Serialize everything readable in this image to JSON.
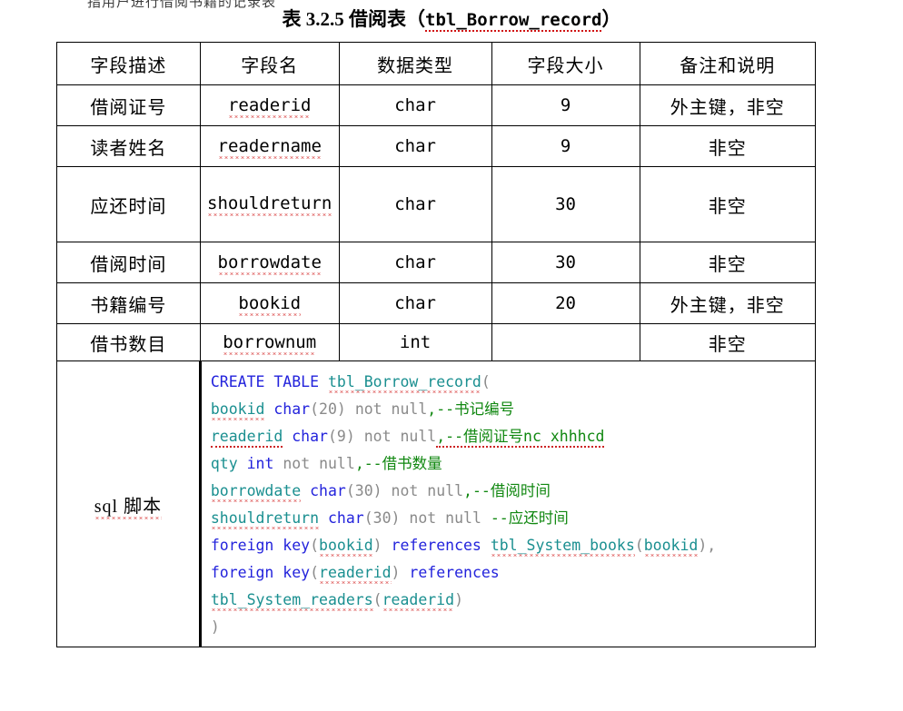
{
  "page": {
    "top_cut_text": "指用户进行借阅书籍的记录表",
    "title_prefix": "表 3.2.5 借阅表（",
    "title_code": "tbl_Borrow_record",
    "title_suffix": "）"
  },
  "table": {
    "headers": [
      "字段描述",
      "字段名",
      "数据类型",
      "字段大小",
      "备注和说明"
    ],
    "rows": [
      {
        "desc": "借阅证号",
        "field": "readerid",
        "type": "char",
        "size": "9",
        "note": "外主键，非空"
      },
      {
        "desc": "读者姓名",
        "field": "readername",
        "type": "char",
        "size": "9",
        "note": "非空"
      },
      {
        "desc": "应还时间",
        "field": "shouldreturn",
        "type": "char",
        "size": "30",
        "note": "非空"
      },
      {
        "desc": "借阅时间",
        "field": "borrowdate",
        "type": "char",
        "size": "30",
        "note": "非空"
      },
      {
        "desc": "书籍编号",
        "field": "bookid",
        "type": "char",
        "size": "20",
        "note": "外主键，非空"
      },
      {
        "desc": "借书数目",
        "field": "borrownum",
        "type": "int",
        "size": "",
        "note": "非空"
      }
    ],
    "sql_label": "sql 脚本"
  },
  "sql": {
    "l1_kw": "CREATE TABLE",
    "l1_id": "tbl_Borrow_record",
    "l1_punc": "(",
    "l2_id": "bookid",
    "l2_type": "char",
    "l2_size": "(20)",
    "l2_gray": "not null",
    "l2_cmt": ",--书记编号",
    "l3_id": "readerid",
    "l3_type": "char",
    "l3_size": "(9)",
    "l3_gray": "not null",
    "l3_cmt": ",--借阅证号nc xhhhcd",
    "l4_id": "qty",
    "l4_type": "int",
    "l4_gray": "not null",
    "l4_cmt": ",--借书数量",
    "l5_id": "borrowdate",
    "l5_type": "char",
    "l5_size": "(30)",
    "l5_gray": "not null",
    "l5_cmt": ",--借阅时间",
    "l6_id": "shouldreturn",
    "l6_type": "char",
    "l6_size": "(30)",
    "l6_gray": "not null",
    "l6_cmt": "--应还时间",
    "l7_kw": "foreign key",
    "l7_p1": "(",
    "l7_id1": "bookid",
    "l7_p2": ")",
    "l7_kw2": "references",
    "l7_id2": "tbl_System_books",
    "l7_p3": "(",
    "l7_id3": "bookid",
    "l7_p4": "),",
    "l8_kw": "foreign key",
    "l8_p1": "(",
    "l8_id1": "readerid",
    "l8_p2": ")",
    "l8_kw2": "references",
    "l9_id": "tbl_System_readers",
    "l9_p1": "(",
    "l9_id2": "readerid",
    "l9_p2": ")",
    "l10_punc": ")"
  },
  "colors": {
    "keyword": "#2323dc",
    "identifier": "#1a8f90",
    "gray": "#8a8a8a",
    "comment": "#118811",
    "spellcheck_underline": "#cc0000",
    "border": "#000000"
  }
}
